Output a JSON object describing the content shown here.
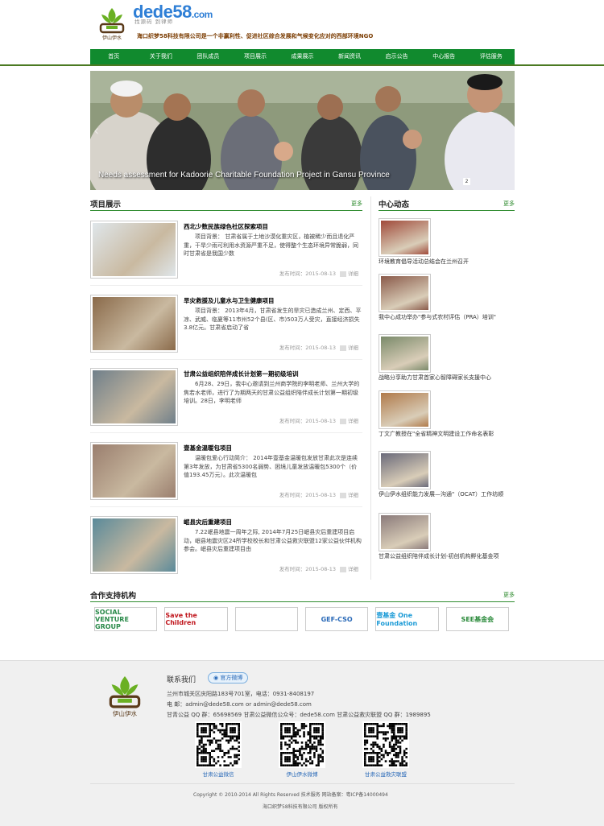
{
  "header": {
    "brand": "dede58",
    "brand_suffix": ".com",
    "brand_tagline": "找源码 到律师",
    "slogan": "海口织梦58科技有限公司是一个非赢利性、促进社区综合发展和气候变化应对的西部环境NGO",
    "logo_text": "伊山伊水"
  },
  "nav": [
    "首页",
    "关于我们",
    "团队成员",
    "项目展示",
    "成果展示",
    "新闻资讯",
    "启示公告",
    "中心报告",
    "评估服务"
  ],
  "banner": {
    "caption": "Needs assessment for Kadoorie Charitable Foundation Project in Gansu Province",
    "slide_number": "2"
  },
  "projects_section": {
    "title": "项目展示",
    "more": "更多",
    "date_label": "发布时间：",
    "detail_label": "详细",
    "items": [
      {
        "title": "西北少数民族绿色社区探索项目",
        "desc": "项目背景： 甘肃省属于土地沙漠化重灾区，植被稀少而且退化严重，干旱少雨可利用水资源严重不足，使得整个生态环境异常脆弱，同时甘肃省是我国少数",
        "date": "2015-08-13",
        "color": "#dfe6ea"
      },
      {
        "title": "旱灾救援及儿童水与卫生健康项目",
        "desc": "项目背景： 2013年4月，甘肃省发生的旱灾已造成兰州、定西、平凉、武威、临夏等11市州52个县(区、市)503万人受灾，直接经济损失3.8亿元。甘肃省启动了省",
        "date": "2015-08-13",
        "color": "#8a6a4a"
      },
      {
        "title": "甘肃公益组织陪伴成长计划第一期初级培训",
        "desc": "6月28、29日，我中心邀请到兰州商学院的李明老师、兰州大学的焦若水老师，进行了为期两天的甘肃公益组织陪伴成长计划第一期初级培训。28日，李明老师",
        "date": "2015-08-13",
        "color": "#6f7f8a"
      },
      {
        "title": "壹基金温暖包项目",
        "desc": "温暖包爱心行动简介： 2014年壹基金温暖包发放甘肃此次是连续第3年发放，为甘肃省5300名弱势、困境儿童发放温暖包5300个（价值193.45万元）。此次温暖包",
        "date": "2015-08-13",
        "color": "#9a7e6e"
      },
      {
        "title": "岷县灾后重建项目",
        "desc": "7.22岷县地震一周年之际, 2014年7月25日岷县灾后重建项目启动，岷县地震灾区24所学校校长和甘肃公益救灾联盟12家公益伙伴机构参会。岷县灾后重建项目由",
        "date": "2015-08-13",
        "color": "#5a8a9a"
      }
    ]
  },
  "news_section": {
    "title": "中心动态",
    "more": "更多",
    "items": [
      {
        "caption": "环境教育倡导活动总结会在兰州召开",
        "color": "#a04a3a"
      },
      {
        "caption": "我中心成功举办\"参与式农村评估（PRA）培训\"",
        "color": "#8a5a4a"
      },
      {
        "caption": "战略分享助力甘肃首家心智障碍家长支援中心",
        "color": "#7a8a6a"
      },
      {
        "caption": "丁文广教授在\"全省精神文明建设工作命名表彰",
        "color": "#b07a4a"
      },
      {
        "caption": "伊山伊水组织能力发展—沟通\"（OCAT）工作坊顺",
        "color": "#6a6a7a"
      },
      {
        "caption": "甘肃公益组织陪伴成长计划-初创机构孵化基金项",
        "color": "#8a7a7a"
      }
    ]
  },
  "partners_section": {
    "title": "合作支持机构",
    "more": "更多",
    "items": [
      {
        "name": "SOCIAL VENTURE GROUP",
        "color": "#2a8a4a"
      },
      {
        "name": "Save the Children",
        "color": "#c0161d"
      },
      {
        "name": "",
        "color": "#2a6a3a"
      },
      {
        "name": "GEF-CSO",
        "color": "#2a6ab8"
      },
      {
        "name": "壹基金 One Foundation",
        "color": "#1a9ad6"
      },
      {
        "name": "SEE基金会",
        "color": "#2a8a3a"
      }
    ]
  },
  "footer": {
    "contact_title": "联系我们",
    "weibo_label": "官方微博",
    "address": "兰州市城关区庆阳路183号701室，电话：0931-8408197",
    "email": "电  邮：admin@dede58.com   or   admin@dede58.com",
    "groups": "甘青公益 QQ 群：65698569    甘肃公益微信公众号：dede58.com    甘肃公益救灾联盟 QQ 群：1989895",
    "qr_captions": [
      "甘肃公益微信",
      "伊山伊水微博",
      "甘肃公益救灾联盟"
    ],
    "copyright": "Copyright © 2010-2014    All Rights Reserved         技术服务      网站备案：粤ICP备14000494",
    "company": "海口织梦58科技有限公司  版权所有"
  }
}
